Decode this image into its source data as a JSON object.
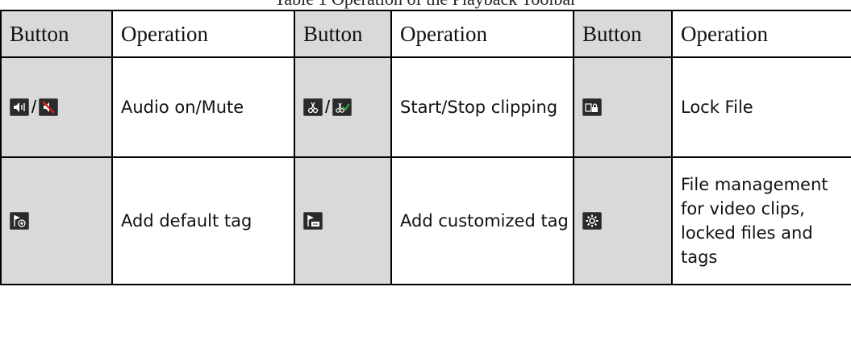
{
  "headers": [
    "Button",
    "Operation",
    "Button",
    "Operation",
    "Button",
    "Operation"
  ],
  "caption_fragment": "Table 1 Operation of the Playback Toolbar",
  "rows": [
    {
      "op1": "Audio on/Mute",
      "op2": "Start/Stop clipping",
      "op3": "Lock File",
      "icons1": [
        "audio-on-icon",
        "mute-icon"
      ],
      "icons2": [
        "start-clip-icon",
        "stop-clip-icon"
      ],
      "icons3": [
        "lock-file-icon"
      ]
    },
    {
      "op1": "Add default tag",
      "op2": "Add customized tag",
      "op3": "File management for video clips, locked files and tags",
      "icons1": [
        "add-default-tag-icon"
      ],
      "icons2": [
        "add-customized-tag-icon"
      ],
      "icons3": [
        "file-management-icon"
      ]
    }
  ],
  "separator": "/",
  "colors": {
    "shade": "#d9d9d9",
    "border": "#000000",
    "icon_bg": "#2a2a2a",
    "mute_red": "#d42020",
    "check_green": "#3ab03a"
  }
}
